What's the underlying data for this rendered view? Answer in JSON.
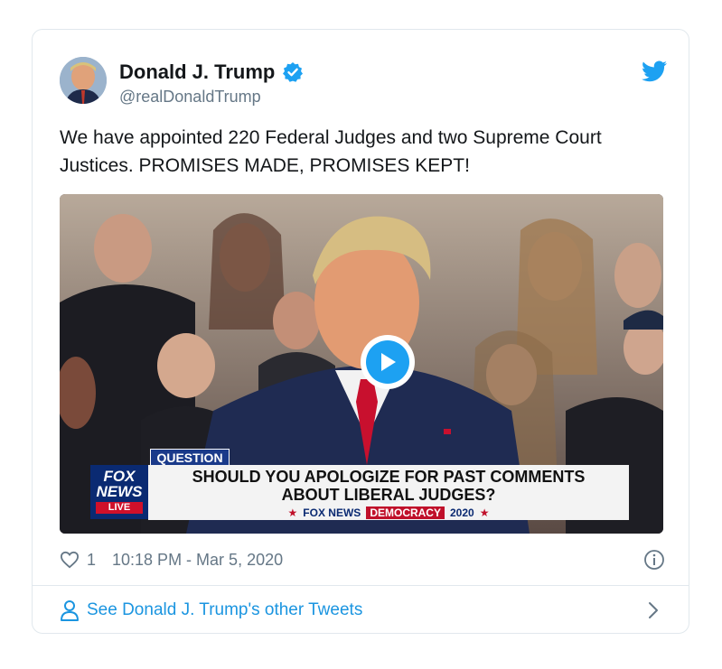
{
  "tweet": {
    "author_name": "Donald J. Trump",
    "author_handle": "@realDonaldTrump",
    "text": "We have appointed 220 Federal Judges and two Supreme Court Justices. PROMISES MADE, PROMISES KEPT!",
    "like_count": "1",
    "timestamp": "10:18 PM - Mar 5, 2020"
  },
  "video": {
    "chyron_tag": "QUESTION",
    "headline_line1": "SHOULD YOU APOLOGIZE FOR PAST COMMENTS",
    "headline_line2": "ABOUT LIBERAL JUDGES?",
    "ticker_brand": "FOX NEWS",
    "ticker_segment": "DEMOCRACY",
    "ticker_year": "2020",
    "logo_line1": "FOX",
    "logo_line2": "NEWS",
    "logo_live": "LIVE"
  },
  "footer": {
    "see_more_label": "See Donald J. Trump's other Tweets"
  },
  "colors": {
    "link_blue": "#1b95e0",
    "twitter_blue": "#1da1f2",
    "muted_gray": "#657786"
  },
  "icons": [
    "avatar",
    "verified-badge-icon",
    "twitter-bird-icon",
    "play-icon",
    "heart-icon",
    "info-icon",
    "person-icon",
    "chevron-right-icon"
  ]
}
